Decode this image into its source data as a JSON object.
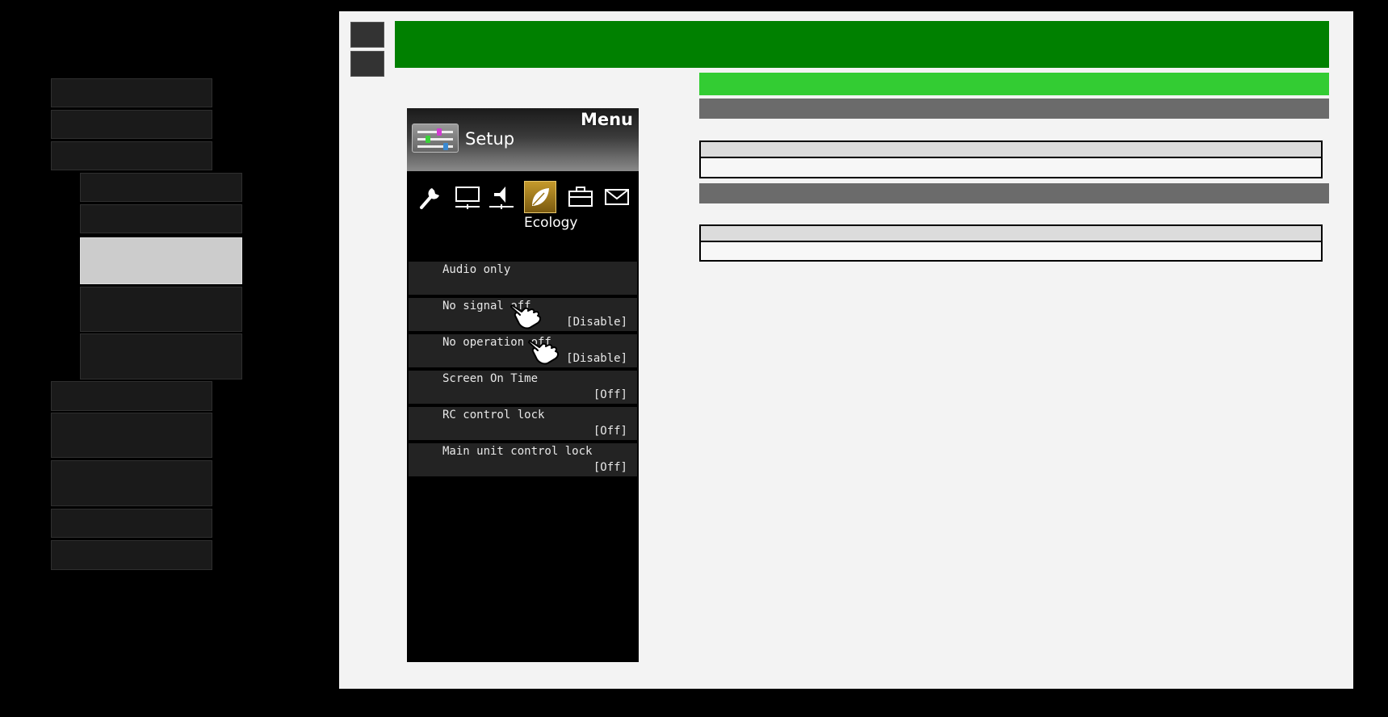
{
  "tv_menu": {
    "title": "Menu",
    "category": "Setup",
    "tab_icons": [
      "wrench-icon",
      "display-icon",
      "speaker-icon",
      "leaf-icon",
      "toolbox-icon",
      "envelope-icon"
    ],
    "selected_tab": "Ecology",
    "items": [
      {
        "label": "Audio only",
        "value": ""
      },
      {
        "label": "No signal off",
        "value": "[Disable]"
      },
      {
        "label": "No operation off",
        "value": "[Disable]"
      },
      {
        "label": "Screen On Time",
        "value": "[Off]"
      },
      {
        "label": "RC control lock",
        "value": "[Off]"
      },
      {
        "label": "Main unit control lock",
        "value": "[Off]"
      }
    ]
  },
  "colors": {
    "header": "#008000",
    "subheader": "#33cc33",
    "section_bar": "#6b6b6b",
    "selected_tab": "#c59a2c"
  }
}
